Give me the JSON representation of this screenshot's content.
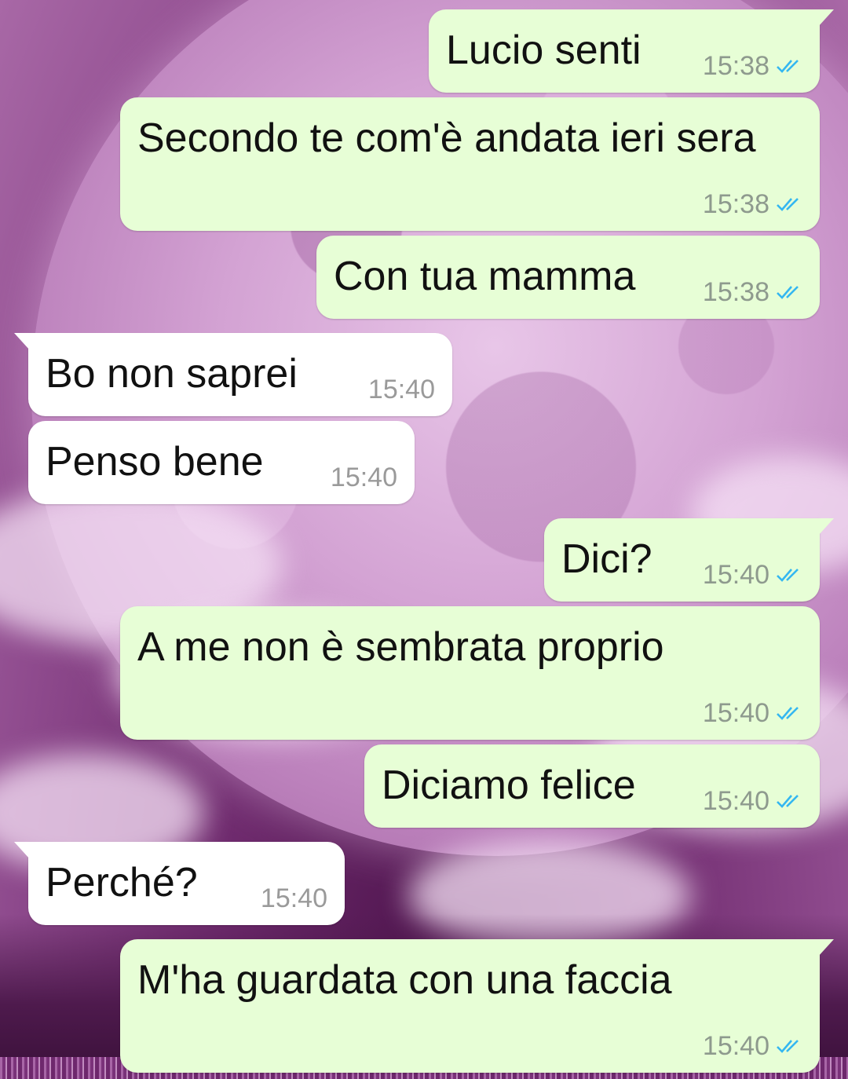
{
  "chat": {
    "accent_read_ticks": "#34b7f1",
    "outgoing_bubble_color": "#e7fed6",
    "incoming_bubble_color": "#ffffff",
    "wallpaper": "pink full moon with clouds",
    "messages": [
      {
        "direction": "out",
        "text": "Lucio senti",
        "time": "15:38",
        "status": "read"
      },
      {
        "direction": "out",
        "text": "Secondo te com'è andata ieri sera",
        "time": "15:38",
        "status": "read"
      },
      {
        "direction": "out",
        "text": "Con tua mamma",
        "time": "15:38",
        "status": "read"
      },
      {
        "direction": "in",
        "text": "Bo non saprei",
        "time": "15:40"
      },
      {
        "direction": "in",
        "text": "Penso bene",
        "time": "15:40"
      },
      {
        "direction": "out",
        "text": "Dici?",
        "time": "15:40",
        "status": "read"
      },
      {
        "direction": "out",
        "text": "A me non è sembrata proprio",
        "time": "15:40",
        "status": "read"
      },
      {
        "direction": "out",
        "text": "Diciamo felice",
        "time": "15:40",
        "status": "read"
      },
      {
        "direction": "in",
        "text": "Perché?",
        "time": "15:40"
      },
      {
        "direction": "out",
        "text": "M'ha guardata con una faccia",
        "time": "15:40",
        "status": "read"
      }
    ]
  }
}
